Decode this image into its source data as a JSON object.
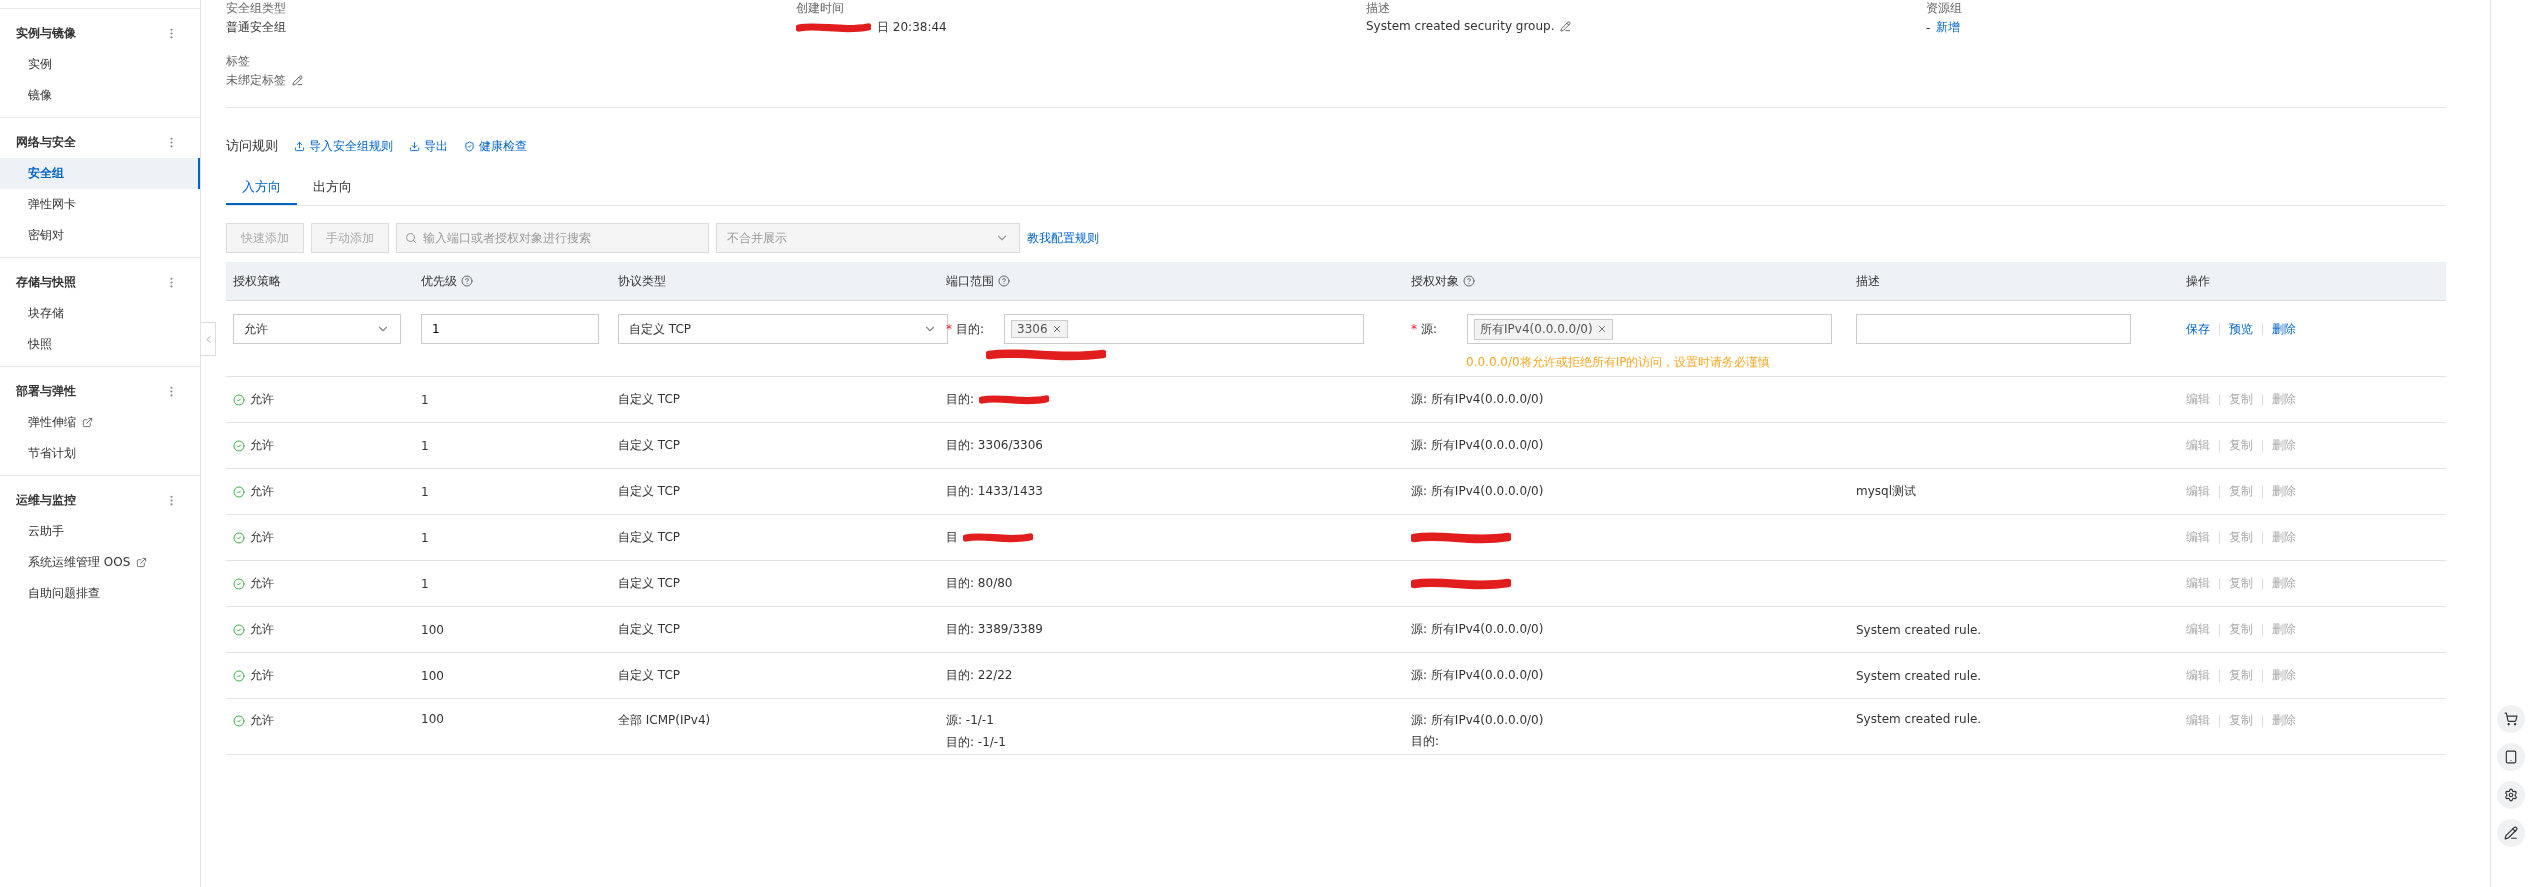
{
  "sidebar": {
    "groups": [
      {
        "title": "实例与镜像",
        "items": [
          {
            "label": "实例",
            "selected": false,
            "external": false
          },
          {
            "label": "镜像",
            "selected": false,
            "external": false
          }
        ]
      },
      {
        "title": "网络与安全",
        "items": [
          {
            "label": "安全组",
            "selected": true,
            "external": false
          },
          {
            "label": "弹性网卡",
            "selected": false,
            "external": false
          },
          {
            "label": "密钥对",
            "selected": false,
            "external": false
          }
        ]
      },
      {
        "title": "存储与快照",
        "items": [
          {
            "label": "块存储",
            "selected": false,
            "external": false
          },
          {
            "label": "快照",
            "selected": false,
            "external": false
          }
        ]
      },
      {
        "title": "部署与弹性",
        "items": [
          {
            "label": "弹性伸缩",
            "selected": false,
            "external": true
          },
          {
            "label": "节省计划",
            "selected": false,
            "external": false
          }
        ]
      },
      {
        "title": "运维与监控",
        "items": [
          {
            "label": "云助手",
            "selected": false,
            "external": false
          },
          {
            "label": "系统运维管理 OOS",
            "selected": false,
            "external": true
          },
          {
            "label": "自助问题排查",
            "selected": false,
            "external": false
          }
        ]
      }
    ]
  },
  "details": {
    "fields": [
      {
        "label": "安全组类型",
        "value": "普通安全组",
        "redacted": false,
        "editable": false
      },
      {
        "label": "创建时间",
        "value": "日 20:38:44",
        "redacted": true,
        "editable": false
      },
      {
        "label": "描述",
        "value": "System created security group.",
        "redacted": false,
        "editable": true
      },
      {
        "label": "资源组",
        "value": "-",
        "link": "新增",
        "redacted": false,
        "editable": false
      }
    ],
    "tag": {
      "label": "标签",
      "value": "未绑定标签"
    }
  },
  "rules": {
    "title": "访问规则",
    "actions": [
      {
        "label": "导入安全组规则"
      },
      {
        "label": "导出"
      },
      {
        "label": "健康检查"
      }
    ],
    "tabs": [
      {
        "label": "入方向",
        "selected": true
      },
      {
        "label": "出方向",
        "selected": false
      }
    ],
    "toolbar": {
      "buttons": [
        {
          "label": "快速添加",
          "disabled": true
        },
        {
          "label": "手动添加",
          "disabled": true
        }
      ],
      "search": {
        "placeholder": "输入端口或者授权对象进行搜索"
      },
      "select": {
        "placeholder": "不合并展示"
      },
      "link": "教我配置规则"
    },
    "columns": [
      {
        "label": "授权策略",
        "help": false
      },
      {
        "label": "优先级",
        "help": true
      },
      {
        "label": "协议类型",
        "help": false
      },
      {
        "label": "端口范围",
        "help": true
      },
      {
        "label": "授权对象",
        "help": true
      },
      {
        "label": "描述",
        "help": false
      },
      {
        "label": "操作",
        "help": false
      }
    ],
    "edit_row": {
      "policy": "允许",
      "priority": "1",
      "protocol": "自定义 TCP",
      "port_mark": "*",
      "port_label": "目的:",
      "port_tag": "3306",
      "source_mark": "*",
      "source_label": "源:",
      "source_tag": "所有IPv4(0.0.0.0/0)",
      "warning": "0.0.0.0/0将允许或拒绝所有IP的访问，设置时请务必谨慎",
      "actions": [
        "保存",
        "预览",
        "删除"
      ]
    },
    "rows": [
      {
        "policy": "允许",
        "priority": "1",
        "protocol": "自定义 TCP",
        "port": [
          "目的:"
        ],
        "port_redacted": true,
        "source": [
          "源: 所有IPv4(0.0.0.0/0)"
        ],
        "source_redacted": false,
        "actions": [
          "编辑",
          "复制",
          "删除"
        ]
      },
      {
        "policy": "允许",
        "priority": "1",
        "protocol": "自定义 TCP",
        "port": [
          "目的: 3306/3306"
        ],
        "port_redacted": false,
        "source": [
          "源: 所有IPv4(0.0.0.0/0)"
        ],
        "source_redacted": false,
        "actions": [
          "编辑",
          "复制",
          "删除"
        ]
      },
      {
        "policy": "允许",
        "priority": "1",
        "protocol": "自定义 TCP",
        "port": [
          "目的: 1433/1433"
        ],
        "port_redacted": false,
        "source": [
          "源: 所有IPv4(0.0.0.0/0)"
        ],
        "source_redacted": false,
        "description": "mysql测试",
        "actions": [
          "编辑",
          "复制",
          "删除"
        ]
      },
      {
        "policy": "允许",
        "priority": "1",
        "protocol": "自定义 TCP",
        "port": [
          "目"
        ],
        "port_redacted": true,
        "source": [],
        "source_redacted": true,
        "actions": [
          "编辑",
          "复制",
          "删除"
        ]
      },
      {
        "policy": "允许",
        "priority": "1",
        "protocol": "自定义 TCP",
        "port": [
          "目的: 80/80"
        ],
        "port_redacted": false,
        "source": [],
        "source_redacted": true,
        "actions": [
          "编辑",
          "复制",
          "删除"
        ]
      },
      {
        "policy": "允许",
        "priority": "100",
        "protocol": "自定义 TCP",
        "port": [
          "目的: 3389/3389"
        ],
        "port_redacted": false,
        "source": [
          "源: 所有IPv4(0.0.0.0/0)"
        ],
        "source_redacted": false,
        "description": "System created rule.",
        "actions": [
          "编辑",
          "复制",
          "删除"
        ]
      },
      {
        "policy": "允许",
        "priority": "100",
        "protocol": "自定义 TCP",
        "port": [
          "目的: 22/22"
        ],
        "port_redacted": false,
        "source": [
          "源: 所有IPv4(0.0.0.0/0)"
        ],
        "source_redacted": false,
        "description": "System created rule.",
        "actions": [
          "编辑",
          "复制",
          "删除"
        ]
      },
      {
        "policy": "允许",
        "priority": "100",
        "protocol": "全部 ICMP(IPv4)",
        "port": [
          "源: -1/-1",
          "目的: -1/-1"
        ],
        "port_redacted": false,
        "source": [
          "源: 所有IPv4(0.0.0.0/0)",
          "目的:"
        ],
        "source_redacted": false,
        "description": "System created rule.",
        "actions": [
          "编辑",
          "复制",
          "删除"
        ]
      }
    ]
  }
}
